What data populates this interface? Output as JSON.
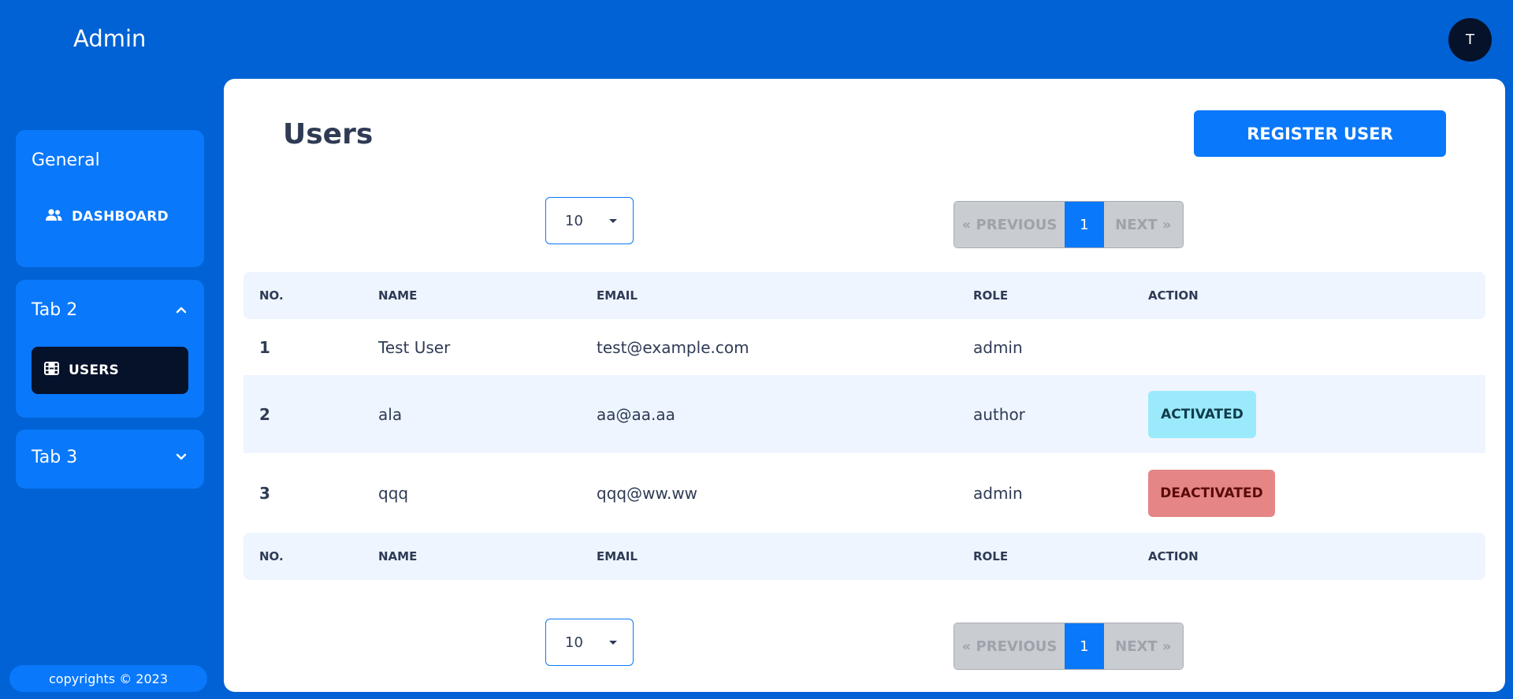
{
  "header": {
    "brand": "Admin",
    "avatar_initial": "T"
  },
  "sidebar": {
    "sections": [
      {
        "title": "General",
        "items": [
          {
            "label": "DASHBOARD",
            "icon": "users-icon"
          }
        ]
      },
      {
        "title": "Tab 2",
        "expanded": true,
        "chevron": "chevron-up-icon",
        "items": [
          {
            "label": "USERS",
            "icon": "film-icon",
            "active": true
          }
        ]
      },
      {
        "title": "Tab 3",
        "expanded": false,
        "chevron": "chevron-down-icon",
        "items": []
      }
    ],
    "copyright": "copyrights © 2023"
  },
  "main": {
    "title": "Users",
    "register_button": "REGISTER USER",
    "page_size": "10",
    "pagination": {
      "previous": "« PREVIOUS",
      "current": "1",
      "next": "NEXT »"
    },
    "table": {
      "headers": [
        "NO.",
        "NAME",
        "EMAIL",
        "ROLE",
        "ACTION"
      ],
      "rows": [
        {
          "no": "1",
          "name": "Test User",
          "email": "test@example.com",
          "role": "admin",
          "action": ""
        },
        {
          "no": "2",
          "name": "ala",
          "email": "aa@aa.aa",
          "role": "author",
          "action": "ACTIVATED"
        },
        {
          "no": "3",
          "name": "qqq",
          "email": "qqq@ww.ww",
          "role": "admin",
          "action": "DEACTIVATED"
        }
      ]
    }
  },
  "colors": {
    "background": "#0062d4",
    "accent": "#0a78fa",
    "dark": "#06112a",
    "activated": "#9beafc",
    "deactivated": "#e58585"
  }
}
